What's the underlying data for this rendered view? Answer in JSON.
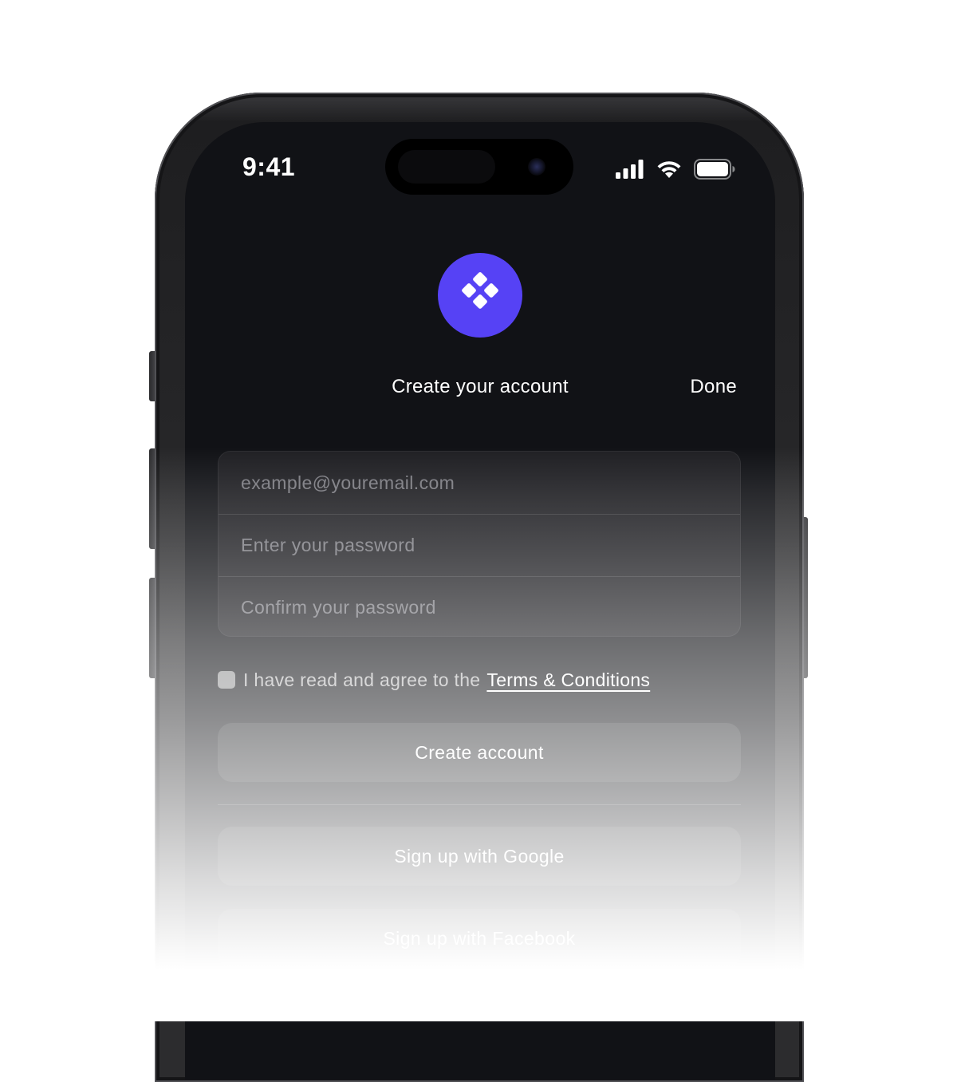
{
  "status_bar": {
    "time": "9:41",
    "icons": [
      "cellular-signal-icon",
      "wifi-icon",
      "battery-icon"
    ]
  },
  "logo": {
    "icon": "diamond-grid-logo",
    "color": "#5642f5"
  },
  "header": {
    "title": "Create your account",
    "done_label": "Done"
  },
  "form": {
    "email_placeholder": "example@youremail.com",
    "password_placeholder": "Enter your password",
    "confirm_placeholder": "Confirm your password"
  },
  "terms": {
    "checked": false,
    "text": "I have read and agree to the",
    "link_text": "Terms & Conditions"
  },
  "buttons": {
    "create_label": "Create account",
    "google_label": "Sign up with Google",
    "facebook_label": "Sign up with Facebook"
  },
  "colors": {
    "screen_background": "#111216",
    "accent": "#5642f5"
  }
}
